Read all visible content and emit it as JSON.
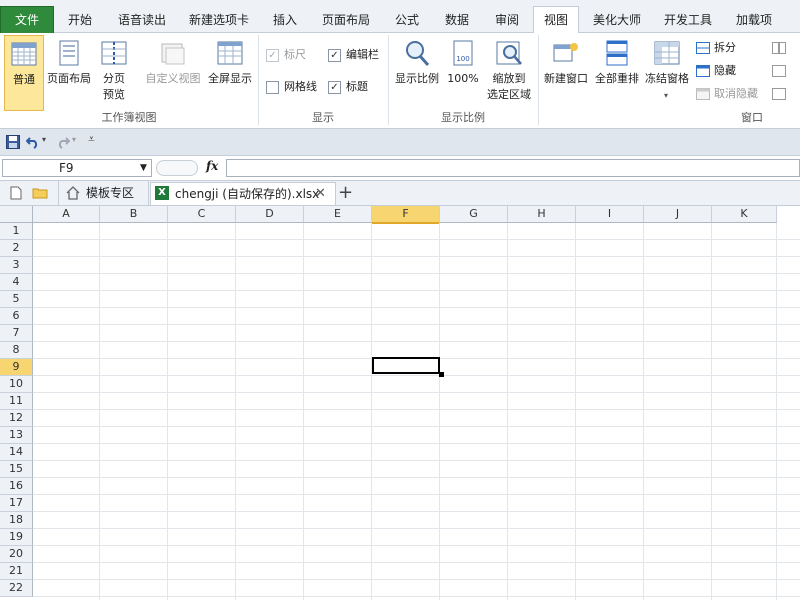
{
  "ribbon_tabs": {
    "file": "文件",
    "home": "开始",
    "voice": "语音读出",
    "newtab": "新建选项卡",
    "insert": "插入",
    "layout": "页面布局",
    "formula": "公式",
    "data": "数据",
    "review": "审阅",
    "view": "视图",
    "beauty": "美化大师",
    "dev": "开发工具",
    "addins": "加载项"
  },
  "workbook_views": {
    "group_label": "工作簿视图",
    "normal": "普通",
    "page_layout": "页面布局",
    "page_break_line1": "分页",
    "page_break_line2": "预览",
    "custom_view": "自定义视图",
    "full_screen": "全屏显示"
  },
  "show": {
    "group_label": "显示",
    "ruler": "标尺",
    "formula_bar": "编辑栏",
    "gridlines": "网格线",
    "headings": "标题",
    "ruler_checked": true,
    "formula_bar_checked": true,
    "gridlines_checked": false,
    "headings_checked": true
  },
  "zoom": {
    "group_label": "显示比例",
    "zoom": "显示比例",
    "hundred": "100%",
    "hundred_icon_text": "100",
    "zoom_sel_line1": "缩放到",
    "zoom_sel_line2": "选定区域"
  },
  "window": {
    "group_label": "窗口",
    "new_window": "新建窗口",
    "arrange_all": "全部重排",
    "freeze": "冻结窗格",
    "split": "拆分",
    "hide": "隐藏",
    "unhide": "取消隐藏"
  },
  "formula_bar": {
    "name_box": "F9",
    "fx": "fx",
    "value": ""
  },
  "doc_tabs": {
    "templates": "模板专区",
    "file_name": "chengji (自动保存的).xlsx",
    "excel_icon_letter": "X"
  },
  "grid": {
    "columns": [
      "A",
      "B",
      "C",
      "D",
      "E",
      "F",
      "G",
      "H",
      "I",
      "J",
      "K"
    ],
    "rows": [
      "1",
      "2",
      "3",
      "4",
      "5",
      "6",
      "7",
      "8",
      "9",
      "10",
      "11",
      "12",
      "13",
      "14",
      "15",
      "16",
      "17",
      "18",
      "19",
      "20",
      "21",
      "22"
    ],
    "selected_col": "F",
    "selected_row": "9"
  },
  "colors": {
    "file_tab": "#2f8a3c",
    "selection_header": "#f7d571",
    "normal_button": "#fde79b"
  }
}
